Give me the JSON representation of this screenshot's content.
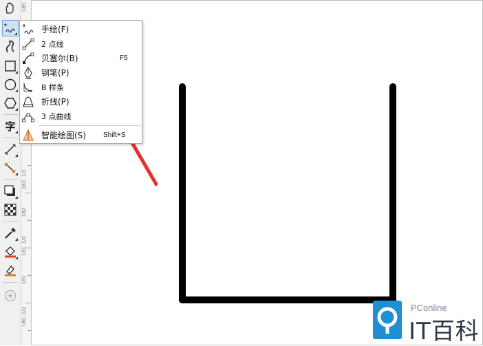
{
  "flyout_menu": {
    "items": [
      {
        "label": "手绘(F)",
        "shortcut": "",
        "icon": "freehand-icon"
      },
      {
        "label": "2 点线",
        "shortcut": "",
        "icon": "two-point-line-icon"
      },
      {
        "label": "贝塞尔(B)",
        "shortcut": "F5",
        "icon": "bezier-icon"
      },
      {
        "label": "钢笔(P)",
        "shortcut": "",
        "icon": "pen-icon"
      },
      {
        "label": "B 样条",
        "shortcut": "",
        "icon": "bspline-icon"
      },
      {
        "label": "折线(P)",
        "shortcut": "",
        "icon": "polyline-icon"
      },
      {
        "label": "3 点曲线",
        "shortcut": "",
        "icon": "three-point-curve-icon"
      },
      {
        "label": "智能绘图(S)",
        "shortcut": "Shift+S",
        "icon": "smart-drawing-icon"
      }
    ]
  },
  "toolbox": {
    "text_tool_glyph": "字",
    "tools": [
      "pan-icon",
      "freehand-tool-icon",
      "artistic-media-icon",
      "rectangle-icon",
      "ellipse-icon",
      "polygon-icon",
      "text-icon",
      "dimension-icon",
      "connector-icon",
      "drop-shadow-icon",
      "transparency-icon",
      "eyedropper-icon",
      "interactive-fill-icon",
      "smart-fill-icon",
      "add-tool-icon"
    ]
  },
  "ruler": {
    "labels": [
      "185",
      "182, 1/2",
      "182",
      "181, 1/2",
      "181",
      "180, 1/2"
    ]
  },
  "watermark": {
    "brand_top": "PConline",
    "brand_main": "IT百科"
  },
  "colors": {
    "arrow": "#e5322d",
    "stroke": "#000000",
    "active_tool_bg": "#cfe3f7"
  }
}
